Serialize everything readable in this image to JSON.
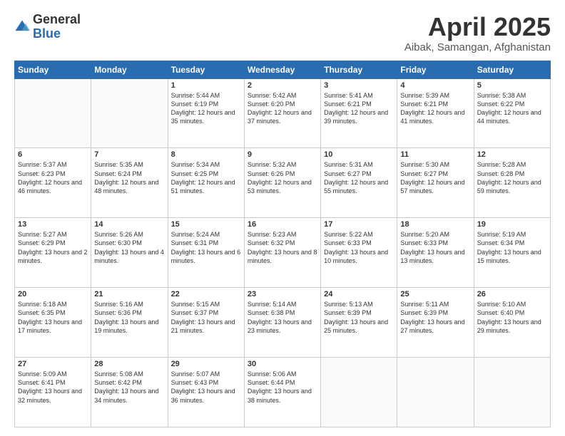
{
  "logo": {
    "general": "General",
    "blue": "Blue"
  },
  "title": "April 2025",
  "subtitle": "Aibak, Samangan, Afghanistan",
  "days_of_week": [
    "Sunday",
    "Monday",
    "Tuesday",
    "Wednesday",
    "Thursday",
    "Friday",
    "Saturday"
  ],
  "weeks": [
    [
      {
        "day": "",
        "info": ""
      },
      {
        "day": "",
        "info": ""
      },
      {
        "day": "1",
        "info": "Sunrise: 5:44 AM\nSunset: 6:19 PM\nDaylight: 12 hours and 35 minutes."
      },
      {
        "day": "2",
        "info": "Sunrise: 5:42 AM\nSunset: 6:20 PM\nDaylight: 12 hours and 37 minutes."
      },
      {
        "day": "3",
        "info": "Sunrise: 5:41 AM\nSunset: 6:21 PM\nDaylight: 12 hours and 39 minutes."
      },
      {
        "day": "4",
        "info": "Sunrise: 5:39 AM\nSunset: 6:21 PM\nDaylight: 12 hours and 41 minutes."
      },
      {
        "day": "5",
        "info": "Sunrise: 5:38 AM\nSunset: 6:22 PM\nDaylight: 12 hours and 44 minutes."
      }
    ],
    [
      {
        "day": "6",
        "info": "Sunrise: 5:37 AM\nSunset: 6:23 PM\nDaylight: 12 hours and 46 minutes."
      },
      {
        "day": "7",
        "info": "Sunrise: 5:35 AM\nSunset: 6:24 PM\nDaylight: 12 hours and 48 minutes."
      },
      {
        "day": "8",
        "info": "Sunrise: 5:34 AM\nSunset: 6:25 PM\nDaylight: 12 hours and 51 minutes."
      },
      {
        "day": "9",
        "info": "Sunrise: 5:32 AM\nSunset: 6:26 PM\nDaylight: 12 hours and 53 minutes."
      },
      {
        "day": "10",
        "info": "Sunrise: 5:31 AM\nSunset: 6:27 PM\nDaylight: 12 hours and 55 minutes."
      },
      {
        "day": "11",
        "info": "Sunrise: 5:30 AM\nSunset: 6:27 PM\nDaylight: 12 hours and 57 minutes."
      },
      {
        "day": "12",
        "info": "Sunrise: 5:28 AM\nSunset: 6:28 PM\nDaylight: 12 hours and 59 minutes."
      }
    ],
    [
      {
        "day": "13",
        "info": "Sunrise: 5:27 AM\nSunset: 6:29 PM\nDaylight: 13 hours and 2 minutes."
      },
      {
        "day": "14",
        "info": "Sunrise: 5:26 AM\nSunset: 6:30 PM\nDaylight: 13 hours and 4 minutes."
      },
      {
        "day": "15",
        "info": "Sunrise: 5:24 AM\nSunset: 6:31 PM\nDaylight: 13 hours and 6 minutes."
      },
      {
        "day": "16",
        "info": "Sunrise: 5:23 AM\nSunset: 6:32 PM\nDaylight: 13 hours and 8 minutes."
      },
      {
        "day": "17",
        "info": "Sunrise: 5:22 AM\nSunset: 6:33 PM\nDaylight: 13 hours and 10 minutes."
      },
      {
        "day": "18",
        "info": "Sunrise: 5:20 AM\nSunset: 6:33 PM\nDaylight: 13 hours and 13 minutes."
      },
      {
        "day": "19",
        "info": "Sunrise: 5:19 AM\nSunset: 6:34 PM\nDaylight: 13 hours and 15 minutes."
      }
    ],
    [
      {
        "day": "20",
        "info": "Sunrise: 5:18 AM\nSunset: 6:35 PM\nDaylight: 13 hours and 17 minutes."
      },
      {
        "day": "21",
        "info": "Sunrise: 5:16 AM\nSunset: 6:36 PM\nDaylight: 13 hours and 19 minutes."
      },
      {
        "day": "22",
        "info": "Sunrise: 5:15 AM\nSunset: 6:37 PM\nDaylight: 13 hours and 21 minutes."
      },
      {
        "day": "23",
        "info": "Sunrise: 5:14 AM\nSunset: 6:38 PM\nDaylight: 13 hours and 23 minutes."
      },
      {
        "day": "24",
        "info": "Sunrise: 5:13 AM\nSunset: 6:39 PM\nDaylight: 13 hours and 25 minutes."
      },
      {
        "day": "25",
        "info": "Sunrise: 5:11 AM\nSunset: 6:39 PM\nDaylight: 13 hours and 27 minutes."
      },
      {
        "day": "26",
        "info": "Sunrise: 5:10 AM\nSunset: 6:40 PM\nDaylight: 13 hours and 29 minutes."
      }
    ],
    [
      {
        "day": "27",
        "info": "Sunrise: 5:09 AM\nSunset: 6:41 PM\nDaylight: 13 hours and 32 minutes."
      },
      {
        "day": "28",
        "info": "Sunrise: 5:08 AM\nSunset: 6:42 PM\nDaylight: 13 hours and 34 minutes."
      },
      {
        "day": "29",
        "info": "Sunrise: 5:07 AM\nSunset: 6:43 PM\nDaylight: 13 hours and 36 minutes."
      },
      {
        "day": "30",
        "info": "Sunrise: 5:06 AM\nSunset: 6:44 PM\nDaylight: 13 hours and 38 minutes."
      },
      {
        "day": "",
        "info": ""
      },
      {
        "day": "",
        "info": ""
      },
      {
        "day": "",
        "info": ""
      }
    ]
  ]
}
